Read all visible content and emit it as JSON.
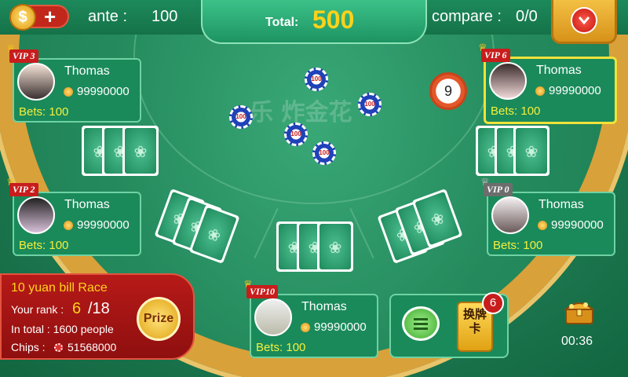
{
  "topbar": {
    "coin_symbol": "$",
    "plus": "+",
    "ante_label": "ante :",
    "ante_value": "100",
    "total_label": "Total:",
    "total_value": "500",
    "compare_label": "compare :",
    "compare_value": "0/0"
  },
  "table": {
    "watermark": "乐 炸金花",
    "timer": "9",
    "chip_label": "100"
  },
  "players": [
    {
      "vip": "VIP 3",
      "name": "Thomas",
      "chips": "99990000",
      "bets": "Bets: 100"
    },
    {
      "vip": "VIP 2",
      "name": "Thomas",
      "chips": "99990000",
      "bets": "Bets: 100"
    },
    {
      "vip": "VIP10",
      "name": "Thomas",
      "chips": "99990000",
      "bets": "Bets: 100"
    },
    {
      "vip": "VIP 6",
      "name": "Thomas",
      "chips": "99990000",
      "bets": "Bets: 100"
    },
    {
      "vip": "VIP 0",
      "name": "Thomas",
      "chips": "99990000",
      "bets": "Bets: 100"
    }
  ],
  "race": {
    "title": "10 yuan bill Race",
    "rank_label": "Your rank :",
    "rank": "6",
    "rank_total": "/18",
    "total": "In total :  1600 people",
    "chips_label": "Chips :",
    "chips": "51568000",
    "prize_label": "Prize"
  },
  "actions": {
    "swap_label": "换牌卡",
    "swap_count": "6"
  },
  "clock": "00:36",
  "colors": {
    "felt": "#1f7d54",
    "rim": "#d9a13a",
    "accent": "#ffd21a",
    "vip_red": "#c81d1d"
  }
}
